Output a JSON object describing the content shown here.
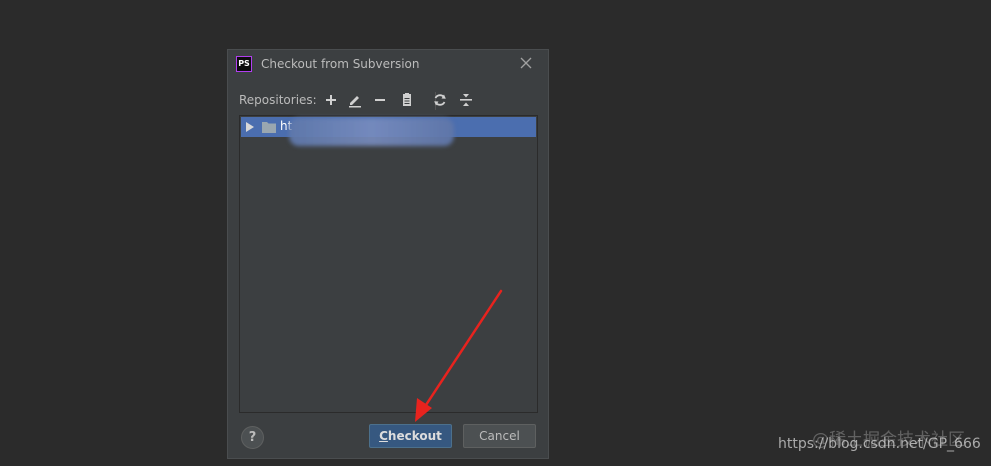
{
  "dialog": {
    "app_icon_text": "PS",
    "title": "Checkout from Subversion"
  },
  "toolbar": {
    "label": "Repositories:",
    "icons": [
      "add-icon",
      "edit-icon",
      "remove-icon",
      "browse-icon",
      "refresh-icon",
      "collapse-icon"
    ]
  },
  "repositories": {
    "items": [
      {
        "url": "ht",
        "selected": true
      }
    ]
  },
  "buttons": {
    "help": "?",
    "checkout_mnemonic": "C",
    "checkout_rest": "heckout",
    "cancel": "Cancel"
  },
  "watermark": {
    "url_text": "https://blog.csdn.net/GP_666",
    "overlay_text": "@稀土掘金技术社区"
  },
  "colors": {
    "background": "#2b2b2b",
    "dialog": "#3c3f41",
    "selection": "#4b6eaf",
    "primary_button": "#365880",
    "annotation_arrow": "#e8231e"
  }
}
